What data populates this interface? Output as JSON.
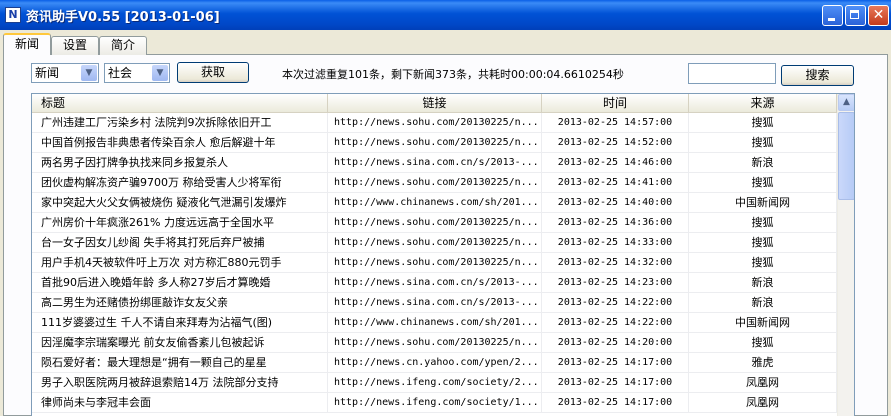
{
  "window": {
    "title": "资讯助手V0.55 [2013-01-06]",
    "icon_letter": "N",
    "close_glyph": "✕"
  },
  "tabs": [
    "新闻",
    "设置",
    "简介"
  ],
  "toolbar": {
    "category_select": "新闻",
    "subcategory_select": "社会",
    "fetch_label": "获取",
    "status_text": "本次过滤重复101条，剩下新闻373条，共耗时00:00:04.6610254秒",
    "search_value": "",
    "search_label": "搜索"
  },
  "table": {
    "columns": [
      "标题",
      "链接",
      "时间",
      "来源"
    ],
    "rows": [
      [
        "广州违建工厂污染乡村 法院判9次拆除依旧开工",
        "http://news.sohu.com/20130225/n...",
        "2013-02-25 14:57:00",
        "搜狐"
      ],
      [
        "中国首例报告非典患者传染百余人 愈后解避十年",
        "http://news.sohu.com/20130225/n...",
        "2013-02-25 14:52:00",
        "搜狐"
      ],
      [
        "两名男子因打牌争执找来同乡报复杀人",
        "http://news.sina.com.cn/s/2013-...",
        "2013-02-25 14:46:00",
        "新浪"
      ],
      [
        "团伙虚构解冻资产骗9700万 称给受害人少将军衔",
        "http://news.sohu.com/20130225/n...",
        "2013-02-25 14:41:00",
        "搜狐"
      ],
      [
        "家中突起大火父女俩被烧伤 疑液化气泄漏引发爆炸",
        "http://www.chinanews.com/sh/201...",
        "2013-02-25 14:40:00",
        "中国新闻网"
      ],
      [
        "广州房价十年疯涨261% 力度远远高于全国水平",
        "http://news.sohu.com/20130225/n...",
        "2013-02-25 14:36:00",
        "搜狐"
      ],
      [
        "台一女子因女儿纱阁 失手将其打死后弃尸被捕",
        "http://news.sohu.com/20130225/n...",
        "2013-02-25 14:33:00",
        "搜狐"
      ],
      [
        "用户手机4天被软件吁上万次 对方称汇880元罚手",
        "http://news.sohu.com/20130225/n...",
        "2013-02-25 14:32:00",
        "搜狐"
      ],
      [
        "首批90后进入晚婚年龄 多人称27岁后才算晚婚",
        "http://news.sina.com.cn/s/2013-...",
        "2013-02-25 14:23:00",
        "新浪"
      ],
      [
        "高二男生为还赌债扮绑匪敲诈女友父亲",
        "http://news.sina.com.cn/s/2013-...",
        "2013-02-25 14:22:00",
        "新浪"
      ],
      [
        "111岁婆婆过生 千人不请自来拜寿为沾福气(图)",
        "http://www.chinanews.com/sh/201...",
        "2013-02-25 14:22:00",
        "中国新闻网"
      ],
      [
        "因淫魔李宗瑞案曝光 前女友偷香紊儿包被起诉",
        "http://news.sohu.com/20130225/n...",
        "2013-02-25 14:20:00",
        "搜狐"
      ],
      [
        "陨石爱好者：最大理想是“拥有一颗自己的星星",
        "http://news.cn.yahoo.com/ypen/2...",
        "2013-02-25 14:17:00",
        "雅虎"
      ],
      [
        "男子入职医院两月被辞退索赔14万 法院部分支持",
        "http://news.ifeng.com/society/2...",
        "2013-02-25 14:17:00",
        "凤凰网"
      ],
      [
        "律师尚未与李冠丰会面",
        "http://news.ifeng.com/society/1...",
        "2013-02-25 14:17:00",
        "凤凰网"
      ]
    ]
  }
}
